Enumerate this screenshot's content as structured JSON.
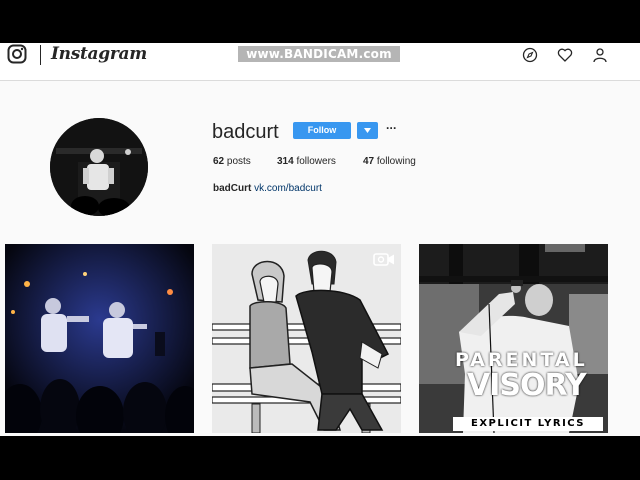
{
  "nav": {
    "wordmark": "Instagram",
    "watermark": "www.BANDICAM.com",
    "icons": [
      "instagram-logo-icon",
      "compass-icon",
      "heart-icon",
      "user-icon"
    ]
  },
  "profile": {
    "username": "badcurt",
    "follow_label": "Follow",
    "more_label": "···",
    "stats": {
      "posts_count": "62",
      "posts_label": " posts",
      "followers_count": "314",
      "followers_label": " followers",
      "following_count": "47",
      "following_label": " following"
    },
    "bio_name": "badCurt",
    "bio_link": "vk.com/badcurt"
  },
  "posts": [
    {
      "description": "concert-photo"
    },
    {
      "description": "illustration-couple-on-bench",
      "badge": "video-icon"
    },
    {
      "description": "parental-advisory-cover",
      "advisory_line1": "PARENTAL",
      "advisory_line2": "VISORY",
      "advisory_line3": "EXPLICIT LYRICS"
    }
  ],
  "colors": {
    "accent": "#3897f0",
    "text": "#262626",
    "link": "#003569",
    "background": "#fafafa",
    "border": "#dbdbdb"
  }
}
